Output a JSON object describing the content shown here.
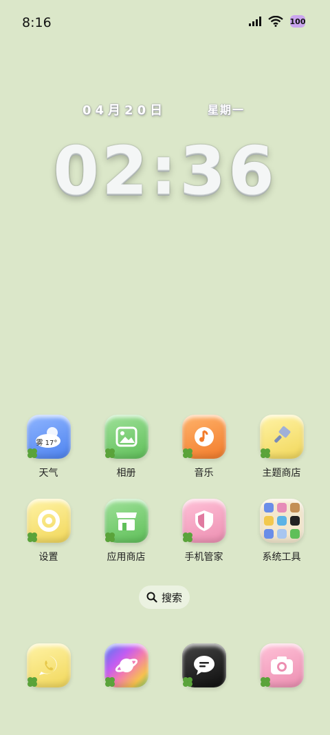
{
  "status_bar": {
    "time": "8:16",
    "battery": "100"
  },
  "lockclock": {
    "date": "04月20日",
    "weekday": "星期一",
    "time": "02:36"
  },
  "apps": [
    {
      "label": "天气",
      "icon": "weather-icon",
      "weather_text": "雾 17°"
    },
    {
      "label": "相册",
      "icon": "gallery-icon"
    },
    {
      "label": "音乐",
      "icon": "music-icon"
    },
    {
      "label": "主题商店",
      "icon": "theme-store-icon"
    },
    {
      "label": "设置",
      "icon": "settings-icon"
    },
    {
      "label": "应用商店",
      "icon": "app-store-icon"
    },
    {
      "label": "手机管家",
      "icon": "phone-manager-icon"
    },
    {
      "label": "系统工具",
      "icon": "system-tools-folder-icon"
    }
  ],
  "search": {
    "label": "搜索"
  },
  "dock": [
    {
      "icon": "phone-icon"
    },
    {
      "icon": "browser-icon"
    },
    {
      "icon": "messages-icon"
    },
    {
      "icon": "camera-icon"
    }
  ]
}
